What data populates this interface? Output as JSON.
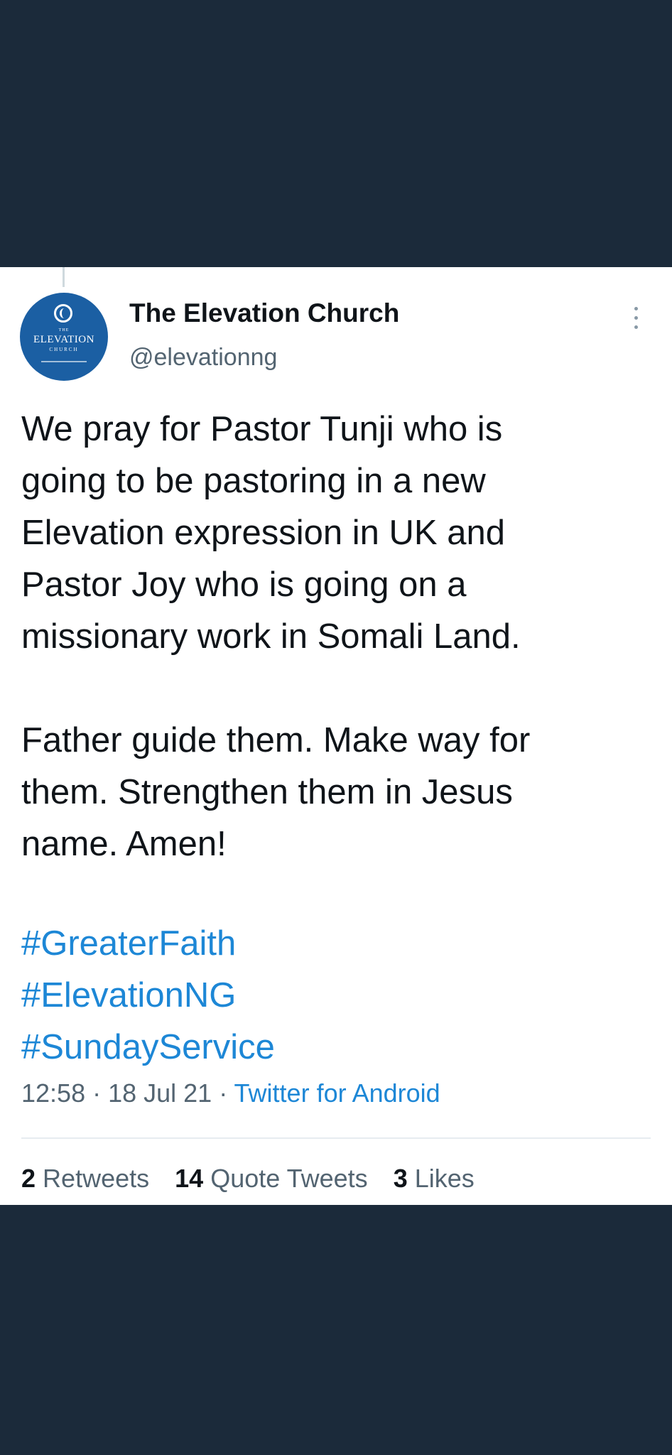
{
  "tweet": {
    "display_name": "The Elevation Church",
    "handle": "@elevationng",
    "avatar": {
      "small_label": "THE",
      "brand": "ELEVATION",
      "sub_label": "CHURCH"
    },
    "more_icon": "more-vertical-icon",
    "body_lines_p1": [
      "We pray for Pastor Tunji who is",
      "going to be pastoring in a new",
      "Elevation expression in UK and",
      "Pastor Joy who is going on a",
      "missionary work in Somali Land."
    ],
    "body_lines_p2": [
      "Father guide them. Make way for",
      "them. Strengthen them in Jesus",
      "name. Amen!"
    ],
    "hashtags": [
      "#GreaterFaith",
      "#ElevationNG",
      "#SundayService"
    ],
    "time": "12:58",
    "separator": " · ",
    "date": "18 Jul 21",
    "source": "Twitter for Android",
    "stats": {
      "retweets_count": "2",
      "retweets_label": "Retweets",
      "quotes_count": "14",
      "quotes_label": "Quote Tweets",
      "likes_count": "3",
      "likes_label": "Likes"
    }
  },
  "colors": {
    "background": "#1b2a3a",
    "card": "#ffffff",
    "link": "#1d87d6",
    "text": "#0f1419",
    "muted": "#536471",
    "avatar": "#1b5fa3"
  }
}
